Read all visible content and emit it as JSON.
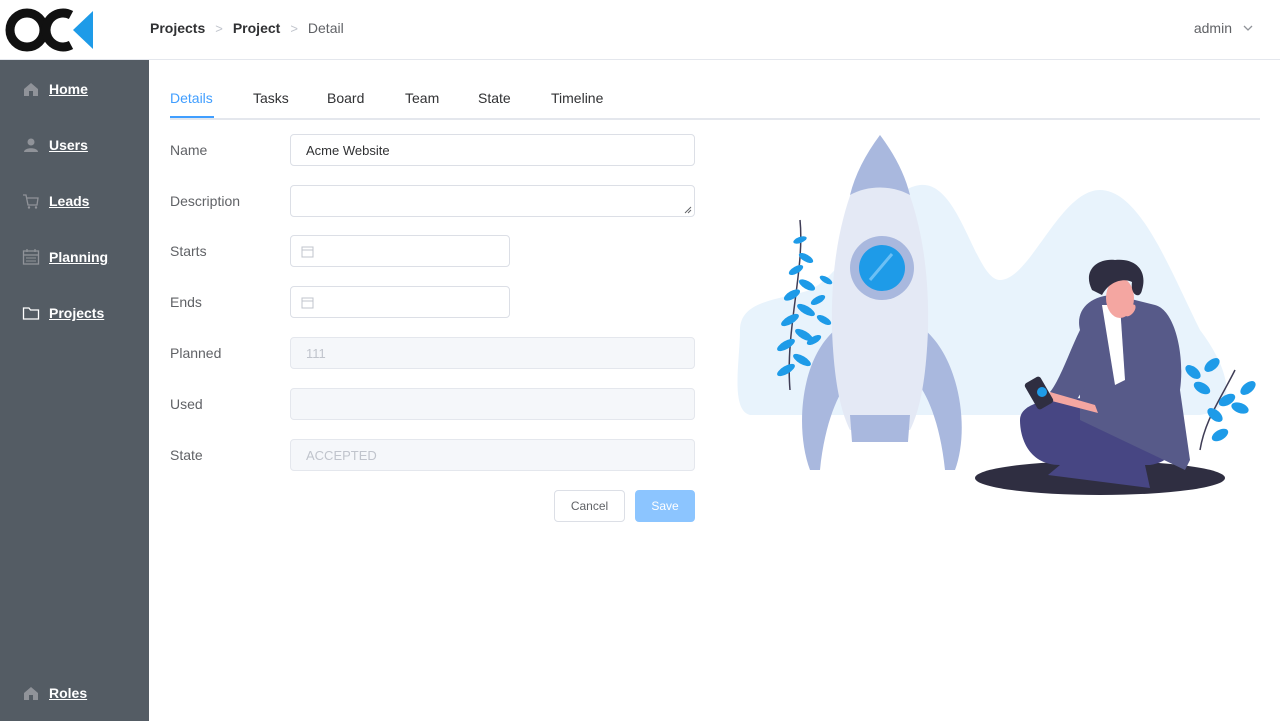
{
  "header": {
    "logo_icon": "oc-logo",
    "breadcrumb": [
      "Projects",
      "Project",
      "Detail"
    ],
    "user": "admin"
  },
  "sidebar": {
    "items": [
      {
        "label": "Home",
        "icon": "home-icon"
      },
      {
        "label": "Users",
        "icon": "user-icon"
      },
      {
        "label": "Leads",
        "icon": "cart-icon"
      },
      {
        "label": "Planning",
        "icon": "calendar-icon"
      },
      {
        "label": "Projects",
        "icon": "folder-icon"
      }
    ],
    "bottom": {
      "label": "Roles",
      "icon": "home-icon"
    }
  },
  "tabs": [
    "Details",
    "Tasks",
    "Board",
    "Team",
    "State",
    "Timeline"
  ],
  "active_tab": "Details",
  "form": {
    "name": {
      "label": "Name",
      "value": "Acme Website"
    },
    "description": {
      "label": "Description",
      "value": ""
    },
    "starts": {
      "label": "Starts",
      "value": ""
    },
    "ends": {
      "label": "Ends",
      "value": ""
    },
    "planned": {
      "label": "Planned",
      "value": "111"
    },
    "used": {
      "label": "Used",
      "value": ""
    },
    "state": {
      "label": "State",
      "value": "ACCEPTED"
    }
  },
  "buttons": {
    "cancel": "Cancel",
    "save": "Save"
  },
  "colors": {
    "accent": "#409eff",
    "sidebar": "#545c64",
    "save_button": "#8cc5ff"
  }
}
